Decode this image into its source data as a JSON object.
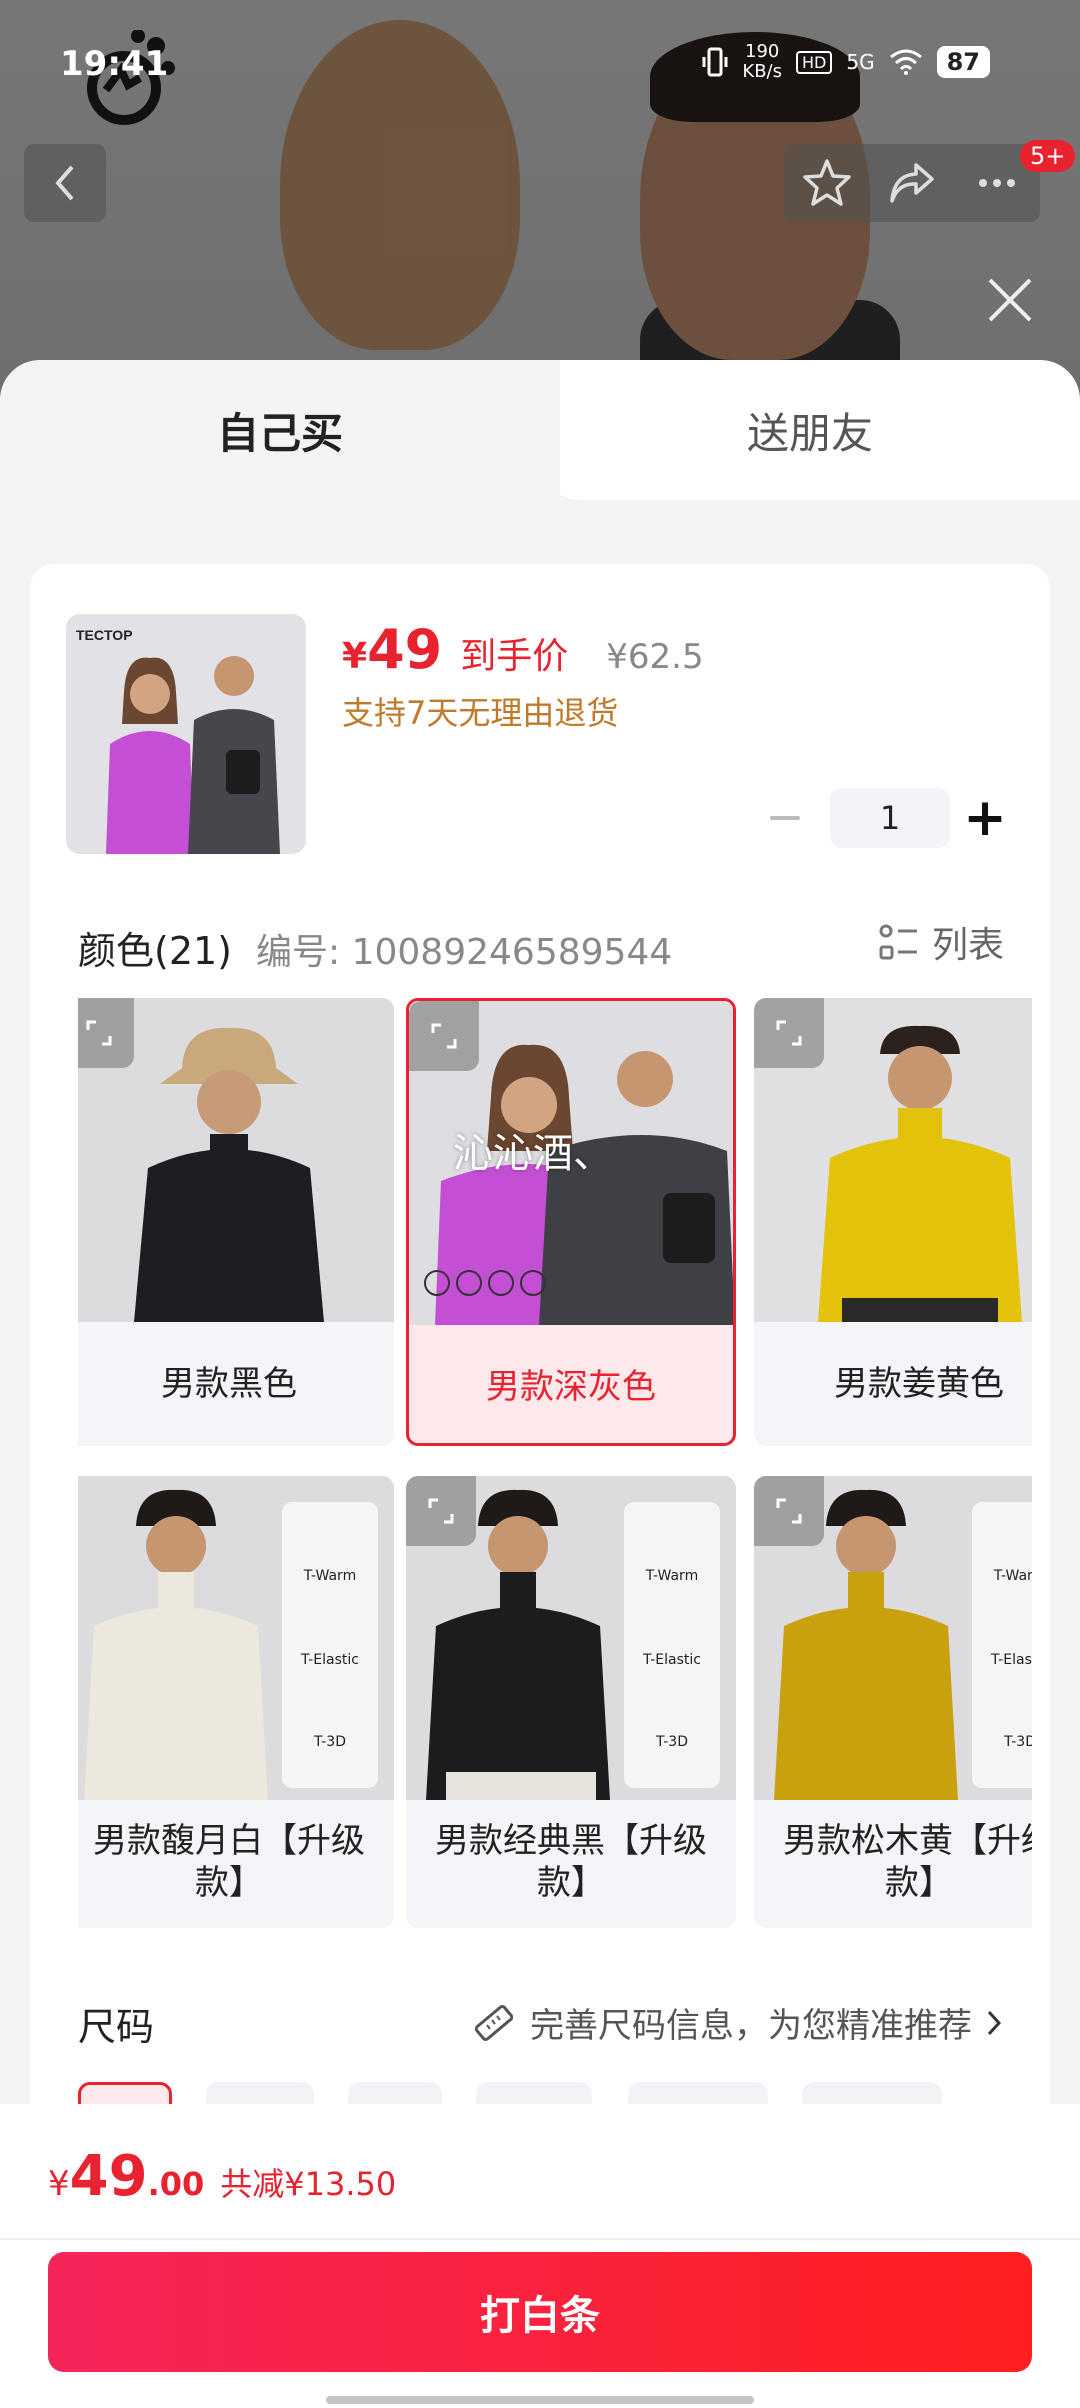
{
  "status_bar": {
    "time": "19:41",
    "speed": "190",
    "speed_unit": "KB/s",
    "hd": "HD",
    "network": "5G",
    "battery": "87"
  },
  "brand": {
    "logo_text": "TECTOP"
  },
  "nav": {
    "badge": "5+"
  },
  "tabs": [
    {
      "label": "自己买"
    },
    {
      "label": "送朋友"
    }
  ],
  "product": {
    "price": "49",
    "price_yen": "¥",
    "price_label": "到手价",
    "original_price": "¥62.5",
    "returns_text": "支持7天无理由退货",
    "quantity": "1"
  },
  "color_section": {
    "title": "颜色(21)",
    "code": "编号: 10089246589544",
    "list_label": "列表",
    "options": [
      {
        "label": "男款黑色",
        "shirt_color": "#1e1e22",
        "selected": false
      },
      {
        "label": "男款深灰色",
        "shirt_color": "#3f4045",
        "selected": true,
        "watermark": "沁沁酒、"
      },
      {
        "label": "男款姜黄色",
        "shirt_color": "#e2c20a",
        "selected": false
      },
      {
        "label": "男款馥月白【升级款】",
        "shirt_color": "#ece8de",
        "selected": false
      },
      {
        "label": "男款经典黑【升级款】",
        "shirt_color": "#1c1c1f",
        "selected": false
      },
      {
        "label": "男款松木黄【升级款】",
        "shirt_color": "#c9a10e",
        "selected": false
      }
    ],
    "feature_badges": [
      "T-Warm",
      "T-Elastic",
      "T-3D"
    ]
  },
  "size_section": {
    "title": "尺码",
    "hint": "完善尺码信息，为您精准推荐"
  },
  "bottom_bar": {
    "total_yen": "¥",
    "total_int": "49",
    "total_dec": ".00",
    "saving": "共减¥13.50",
    "buy_label": "打白条"
  },
  "colors": {
    "accent": "#e8232f",
    "returns": "#c07a2c"
  }
}
